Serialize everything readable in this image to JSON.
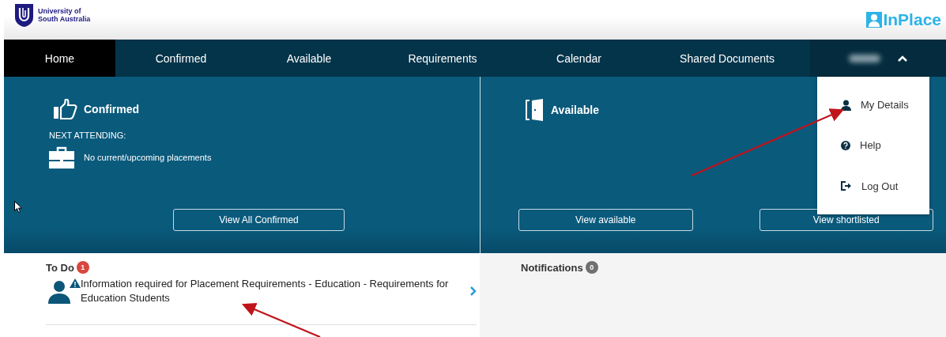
{
  "header": {
    "university_lines": [
      "University of",
      "South Australia"
    ],
    "brand": "InPlace"
  },
  "nav": {
    "tabs": [
      {
        "label": "Home",
        "selected": true
      },
      {
        "label": "Confirmed",
        "selected": false
      },
      {
        "label": "Available",
        "selected": false
      },
      {
        "label": "Requirements",
        "selected": false
      },
      {
        "label": "Calendar",
        "selected": false
      },
      {
        "label": "Shared Documents",
        "selected": false
      }
    ],
    "user_menu": {
      "expanded": true,
      "items": [
        {
          "kind": "details",
          "label": "My Details"
        },
        {
          "kind": "help",
          "label": "Help"
        },
        {
          "kind": "logout",
          "label": "Log Out"
        }
      ]
    }
  },
  "tiles": [
    {
      "kind": "confirmed",
      "title": "Confirmed",
      "subtitle": "NEXT ATTENDING:",
      "message": "No current/upcoming placements",
      "buttons": [
        "View All Confirmed"
      ]
    },
    {
      "kind": "available",
      "title": "Available",
      "buttons": [
        "View available",
        "View shortlisted"
      ]
    }
  ],
  "todo": {
    "title": "To Do",
    "count": "1",
    "items": [
      "Information required for Placement Requirements - Education - Requirements for Education Students"
    ]
  },
  "notifications": {
    "title": "Notifications",
    "count": "0"
  }
}
